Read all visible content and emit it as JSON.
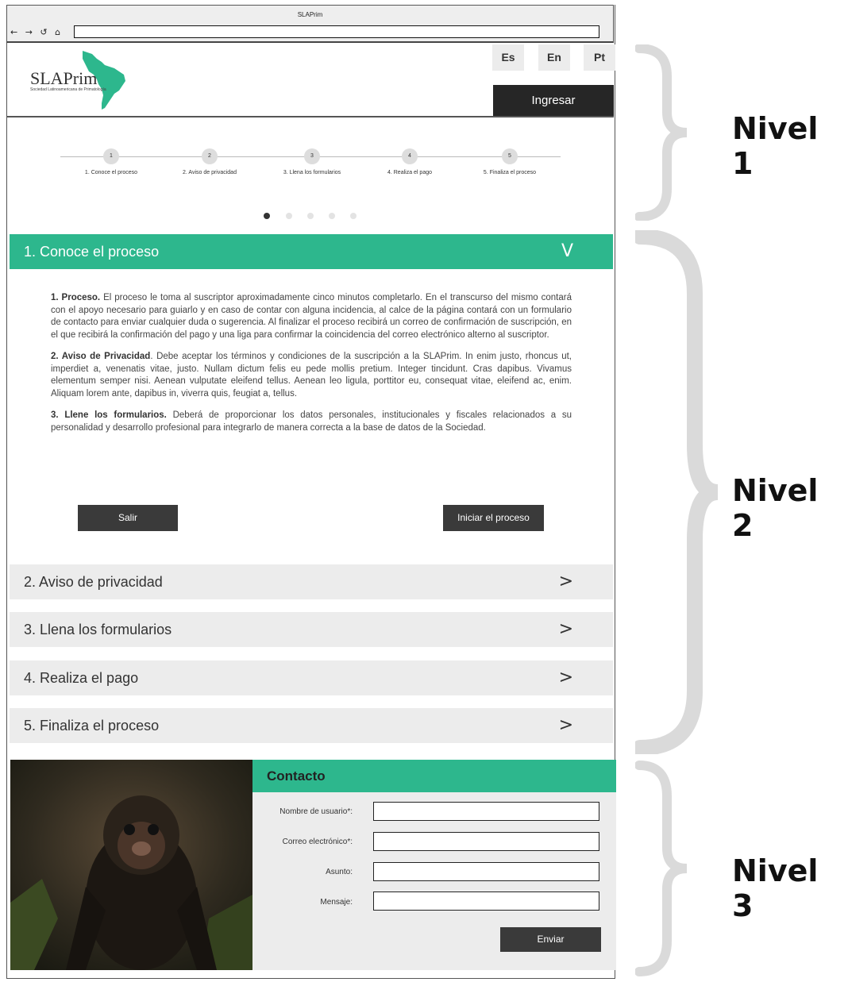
{
  "browser": {
    "title": "SLAPrim",
    "nav_icons": "← → ↺ ⌂"
  },
  "header": {
    "logo_name": "SLAPrim",
    "logo_subtitle": "Sociedad Latinoamericana de Primatología",
    "languages": [
      "Es",
      "En",
      "Pt"
    ],
    "login_label": "Ingresar"
  },
  "stepper": {
    "steps": [
      {
        "num": "1",
        "label": "1. Conoce el proceso"
      },
      {
        "num": "2",
        "label": "2. Aviso de privacidad"
      },
      {
        "num": "3",
        "label": "3. Llena los formularios"
      },
      {
        "num": "4",
        "label": "4. Realiza el pago"
      },
      {
        "num": "5",
        "label": "5. Finaliza el proceso"
      }
    ],
    "active_dot": 1
  },
  "accordion": {
    "open_section": {
      "title": "1. Conoce el proceso",
      "arrow": "V",
      "paragraphs": [
        {
          "bold": "1. Proceso.",
          "text": " El proceso le toma al suscriptor aproximadamente cinco minutos completarlo. En el transcurso del mismo contará con el apoyo necesario para guiarlo y en caso de contar con alguna incidencia, al calce de la página contará con un formulario de contacto para enviar cualquier duda o sugerencia. Al finalizar el proceso recibirá un correo de confirmación de suscripción, en el que recibirá la confirmación del pago y una liga para confirmar la coincidencia del correo electrónico alterno al suscriptor."
        },
        {
          "bold": "2. Aviso de Privacidad",
          "text": ". Debe aceptar los términos y condiciones de la suscripción a la SLAPrim. In enim justo, rhoncus ut, imperdiet a, venenatis vitae, justo. Nullam dictum felis eu pede mollis pretium. Integer tincidunt. Cras dapibus. Vivamus elementum semper nisi. Aenean vulputate eleifend tellus. Aenean leo ligula, porttitor eu, consequat vitae, eleifend ac, enim. Aliquam lorem ante, dapibus in, viverra quis, feugiat a, tellus."
        },
        {
          "bold": "3. Llene los formularios.",
          "text": " Deberá de proporcionar los datos personales, institucionales y fiscales relacionados a su personalidad y desarrollo profesional para integrarlo de manera correcta a la base de datos de la Sociedad."
        }
      ],
      "exit_label": "Salir",
      "start_label": "Iniciar el proceso"
    },
    "closed_sections": [
      {
        "title": "2. Aviso de privacidad",
        "arrow": ">"
      },
      {
        "title": "3. Llena los formularios",
        "arrow": ">"
      },
      {
        "title": "4. Realiza el pago",
        "arrow": ">"
      },
      {
        "title": "5. Finaliza el proceso",
        "arrow": ">"
      }
    ]
  },
  "contact": {
    "title": "Contacto",
    "fields": [
      {
        "label": "Nombre de usuario*:"
      },
      {
        "label": "Correo electrónico*:"
      },
      {
        "label": "Asunto:"
      },
      {
        "label": "Mensaje:"
      }
    ],
    "send_label": "Enviar"
  },
  "annotations": [
    "Nivel 1",
    "Nivel 2",
    "Nivel 3"
  ],
  "colors": {
    "accent": "#2db78d",
    "dark": "#262626",
    "light": "#ececec"
  }
}
